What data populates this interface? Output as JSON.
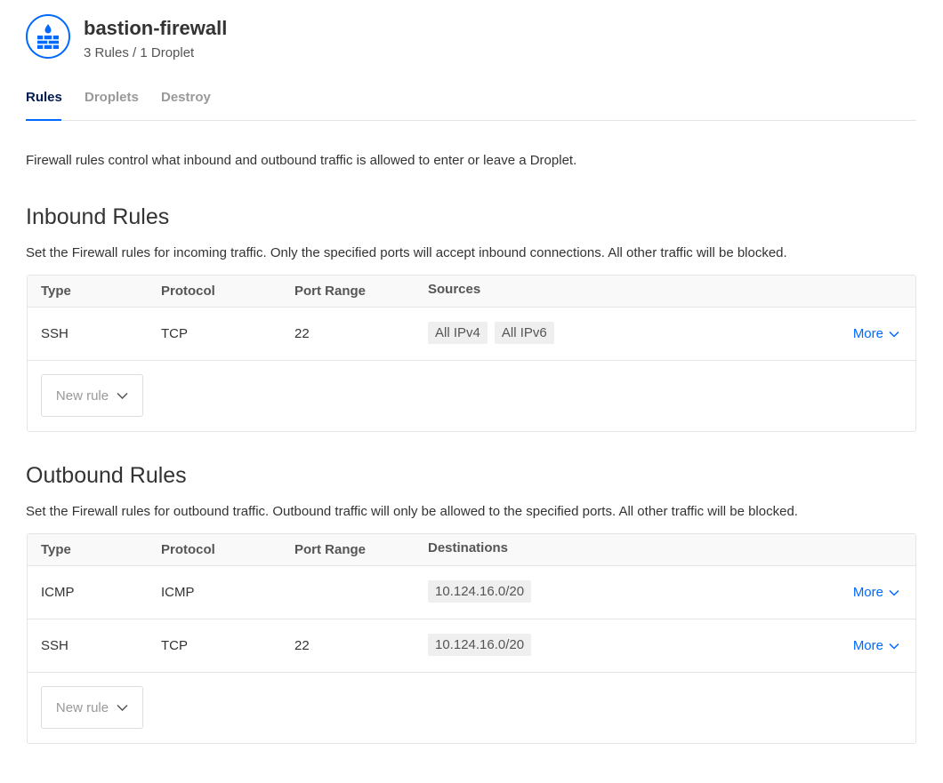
{
  "header": {
    "title": "bastion-firewall",
    "subtitle": "3 Rules / 1 Droplet",
    "icon": "firewall-icon",
    "accent_color": "#0069ff"
  },
  "tabs": [
    {
      "label": "Rules",
      "active": true
    },
    {
      "label": "Droplets",
      "active": false
    },
    {
      "label": "Destroy",
      "active": false
    }
  ],
  "intro": "Firewall rules control what inbound and outbound traffic is allowed to enter or leave a Droplet.",
  "inbound": {
    "title": "Inbound Rules",
    "description": "Set the Firewall rules for incoming traffic. Only the specified ports will accept inbound connections. All other traffic will be blocked.",
    "columns": [
      "Type",
      "Protocol",
      "Port Range",
      "Sources"
    ],
    "rows": [
      {
        "type": "SSH",
        "protocol": "TCP",
        "port": "22",
        "targets": [
          "All IPv4",
          "All IPv6"
        ],
        "more": "More"
      }
    ],
    "new_rule": "New rule"
  },
  "outbound": {
    "title": "Outbound Rules",
    "description": "Set the Firewall rules for outbound traffic. Outbound traffic will only be allowed to the specified ports. All other traffic will be blocked.",
    "columns": [
      "Type",
      "Protocol",
      "Port Range",
      "Destinations"
    ],
    "rows": [
      {
        "type": "ICMP",
        "protocol": "ICMP",
        "port": "",
        "targets": [
          "10.124.16.0/20"
        ],
        "more": "More"
      },
      {
        "type": "SSH",
        "protocol": "TCP",
        "port": "22",
        "targets": [
          "10.124.16.0/20"
        ],
        "more": "More"
      }
    ],
    "new_rule": "New rule"
  }
}
